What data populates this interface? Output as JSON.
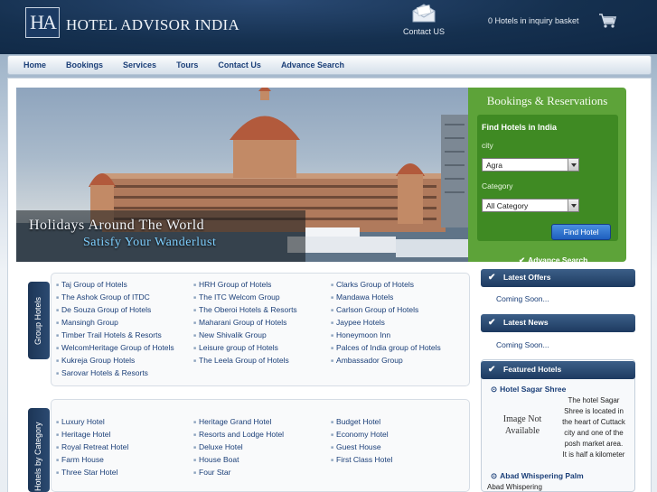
{
  "header": {
    "logo_letters": "HA",
    "brand": "HOTEL ADVISOR INDIA",
    "contact_label": "Contact US",
    "basket_text": "0 Hotels in inquiry basket"
  },
  "nav": {
    "items": [
      "Home",
      "Bookings",
      "Services",
      "Tours",
      "Contact Us",
      "Advance Search"
    ]
  },
  "banner": {
    "line1": "Holidays Around The World",
    "line2": "Satisfy Your Wanderlust"
  },
  "booking": {
    "title": "Bookings & Reservations",
    "find_title": "Find Hotels in India",
    "city_label": "city",
    "city_value": "Agra",
    "category_label": "Category",
    "category_value": "All Category",
    "find_button": "Find Hotel",
    "advance_search": "Advance Search"
  },
  "group_hotels": {
    "tab_label": "Group Hotels",
    "col1": [
      "Taj Group of Hotels",
      "The Ashok Group of ITDC",
      "De Souza Group of Hotels",
      "Mansingh Group",
      "Timber Trail Hotels & Resorts",
      "WelcomHeritage Group of Hotels",
      "Kukreja Group Hotels",
      "Sarovar Hotels & Resorts"
    ],
    "col2": [
      "HRH Group of Hotels",
      "The ITC Welcom Group",
      "The Oberoi Hotels & Resorts",
      "Maharani Group of Hotels",
      "New Shivalik Group",
      "Leisure group of Hotels",
      "The Leela Group of Hotels"
    ],
    "col3": [
      "Clarks Group of Hotels",
      "Mandawa Hotels",
      "Carlson Group of Hotels",
      "Jaypee Hotels",
      "Honeymoon Inn",
      "Palces of India group of Hotels",
      "Ambassador Group"
    ]
  },
  "category_hotels": {
    "tab_label": "Hotels by Category",
    "col1": [
      "Luxury Hotel",
      "Heritage Hotel",
      "Royal Retreat Hotel",
      "Farm House",
      "Three Star Hotel"
    ],
    "col2": [
      "Heritage Grand Hotel",
      "Resorts and Lodge Hotel",
      "Deluxe Hotel",
      "House Boat",
      "Four Star"
    ],
    "col3": [
      "Budget Hotel",
      "Economy Hotel",
      "Guest House",
      "First Class Hotel"
    ]
  },
  "sidebar": {
    "latest_offers": "Latest Offers",
    "offers_text": "Coming Soon...",
    "latest_news": "Latest News",
    "news_text": "Coming Soon...",
    "featured_title": "Featured Hotels",
    "hotel1_name": "Hotel Sagar Shree",
    "hotel1_noimg": "Image Not Available",
    "hotel1_desc": "The hotel Sagar Shree is located in the heart of Cuttack city and one of the posh market area. It is half a kilometer",
    "hotel2_name": "Abad Whispering Palm",
    "hotel2_desc": "Abad Whispering"
  },
  "colors": {
    "header_bg": "#15304f",
    "booking_green": "#5da339",
    "link_blue": "#1b3f78"
  }
}
